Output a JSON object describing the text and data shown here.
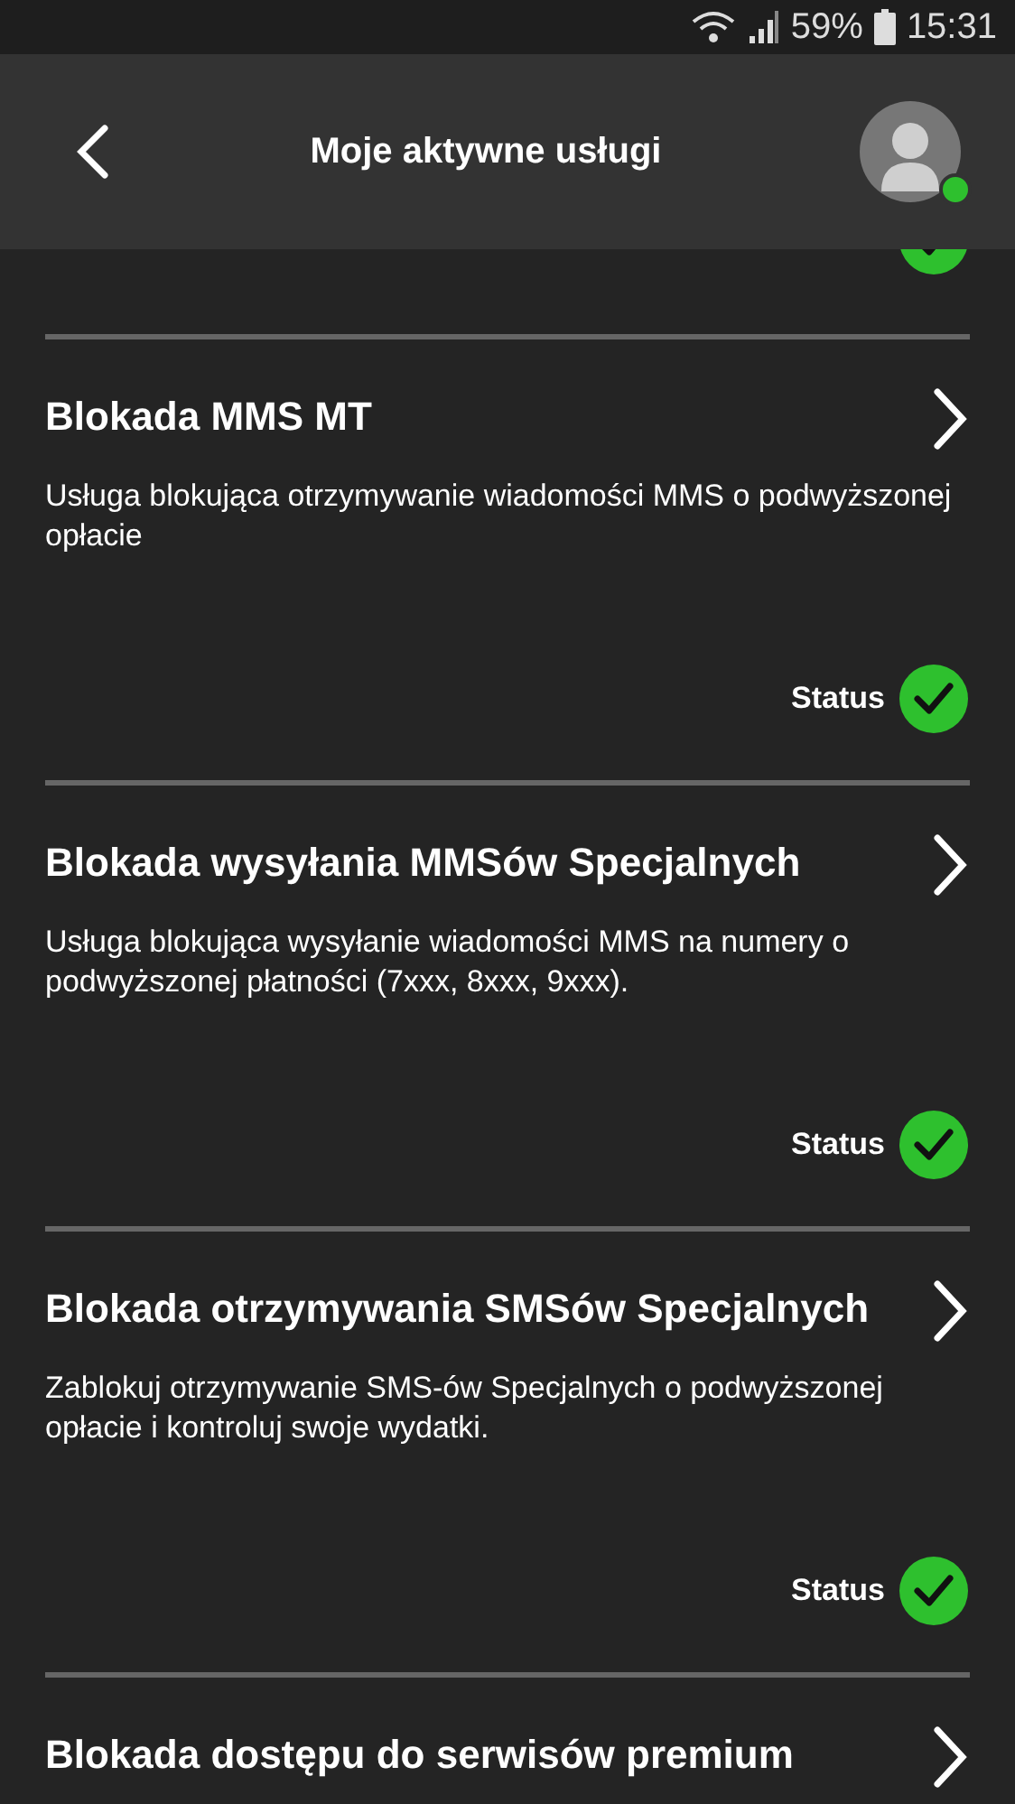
{
  "status_bar": {
    "battery": "59%",
    "time": "15:31"
  },
  "header": {
    "title": "Moje aktywne usługi",
    "online": true
  },
  "top_partial": {
    "active": true
  },
  "services": [
    {
      "title": "Blokada MMS MT",
      "description": "Usługa blokująca otrzymywanie wiadomości MMS o podwyższonej opłacie",
      "status_label": "Status",
      "active": true
    },
    {
      "title": "Blokada wysyłania MMSów Specjalnych",
      "description": "Usługa blokująca wysyłanie wiadomości MMS na numery o podwyższonej płatności (7xxx, 8xxx, 9xxx).",
      "status_label": "Status",
      "active": true
    },
    {
      "title": "Blokada otrzymywania SMSów Specjalnych",
      "description": "Zablokuj otrzymywanie SMS-ów Specjalnych o podwyższonej opłacie i kontroluj swoje wydatki.",
      "status_label": "Status",
      "active": true
    },
    {
      "title": "Blokada dostępu do serwisów premium"
    }
  ]
}
